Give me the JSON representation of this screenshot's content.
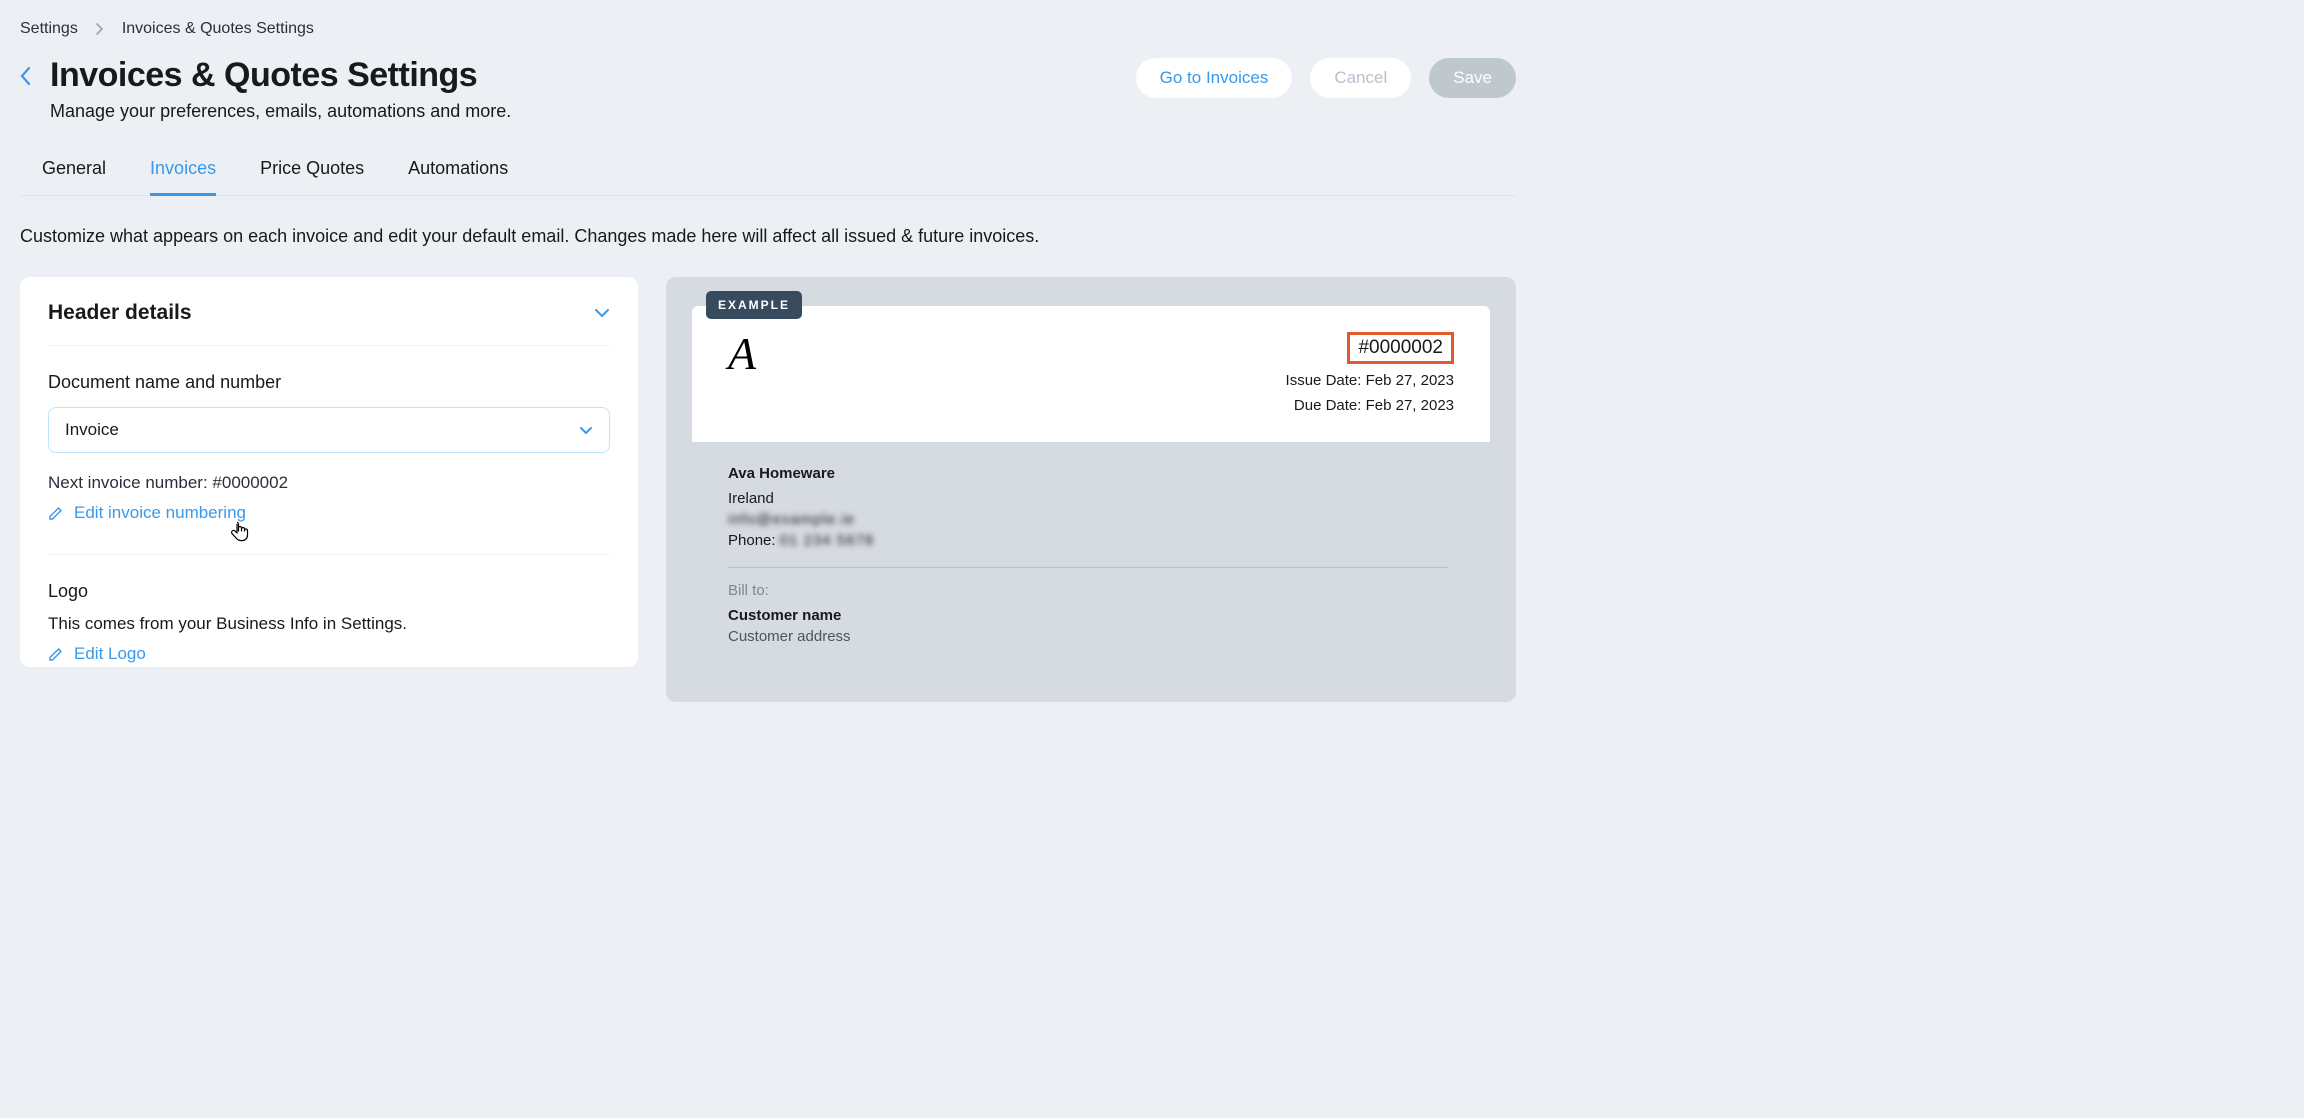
{
  "breadcrumbs": {
    "root": "Settings",
    "current": "Invoices & Quotes Settings"
  },
  "page": {
    "title": "Invoices & Quotes Settings",
    "subtitle": "Manage your preferences, emails, automations and more."
  },
  "actions": {
    "goToInvoices": "Go to Invoices",
    "cancel": "Cancel",
    "save": "Save"
  },
  "tabs": {
    "general": "General",
    "invoices": "Invoices",
    "priceQuotes": "Price Quotes",
    "automations": "Automations"
  },
  "description": "Customize what appears on each invoice and edit your default email. Changes made here will affect all issued & future invoices.",
  "card": {
    "headerTitle": "Header details",
    "docSectionLabel": "Document name and number",
    "selectValue": "Invoice",
    "nextNumberLine": "Next invoice number: #0000002",
    "editNumberingLink": "Edit invoice numbering",
    "logoTitle": "Logo",
    "logoHint": "This comes from your Business Info in Settings.",
    "editLogoLink": "Edit Logo"
  },
  "preview": {
    "badge": "EXAMPLE",
    "logoLetter": "A",
    "invoiceNumber": "#0000002",
    "issueDate": "Issue Date: Feb 27, 2023",
    "dueDate": "Due Date: Feb 27, 2023",
    "businessName": "Ava Homeware",
    "country": "Ireland",
    "emailBlurred": "info@example.ie",
    "phoneLabel": "Phone:",
    "phoneBlurred": "01 234 5678",
    "billToLabel": "Bill to:",
    "customerName": "Customer name",
    "customerAddress": "Customer address"
  }
}
